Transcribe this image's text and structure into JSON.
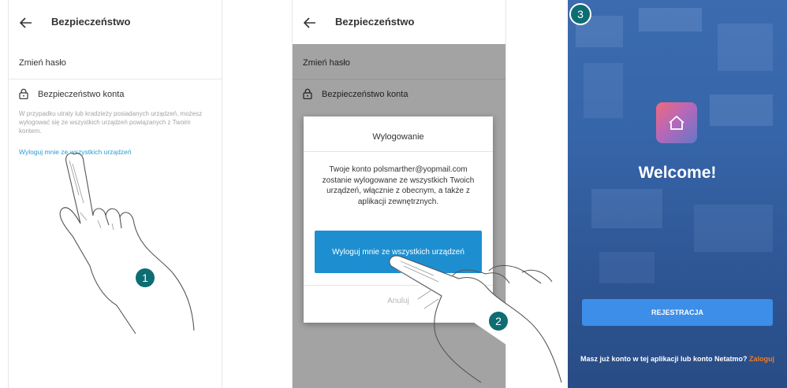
{
  "step1": {
    "title": "Bezpieczeństwo",
    "change_password": "Zmień hasło",
    "account_security": "Bezpieczeństwo konta",
    "description": "W przypadku utraty lub kradzieży posiadanych urządzeń, możesz wylogować się ze wszystkich urządzeń powiązanych z Twoim kontem.",
    "logout_link": "Wyloguj mnie ze wszystkich urządzeń",
    "badge": "1"
  },
  "step2": {
    "title": "Bezpieczeństwo",
    "change_password": "Zmień hasło",
    "account_security": "Bezpieczeństwo konta",
    "dialog": {
      "title": "Wylogowanie",
      "body": "Twoje konto polsmarther@yopmail.com zostanie wylogowane ze wszystkich Twoich urządzeń, włącznie z obecnym, a także z aplikacji zewnętrznych.",
      "confirm_label": "Wyloguj mnie ze wszystkich urządzeń",
      "cancel_label": "Anuluj"
    },
    "badge": "2"
  },
  "step3": {
    "welcome": "Welcome!",
    "register_label": "REJESTRACJA",
    "have_account": "Masz już konto w tej aplikacji lub konto Netatmo?",
    "login_label": "Zaloguj",
    "badge": "3"
  },
  "colors": {
    "link": "#2a9bd6",
    "primary_button": "#1d8fd1",
    "register_button": "#3d8ee8",
    "login_accent": "#f07c2a",
    "badge": "#0d6d72",
    "welcome_bg": "#3665a9"
  },
  "icons": [
    "back-arrow-icon",
    "lock-icon",
    "home-icon",
    "hand-pointer-icon"
  ]
}
